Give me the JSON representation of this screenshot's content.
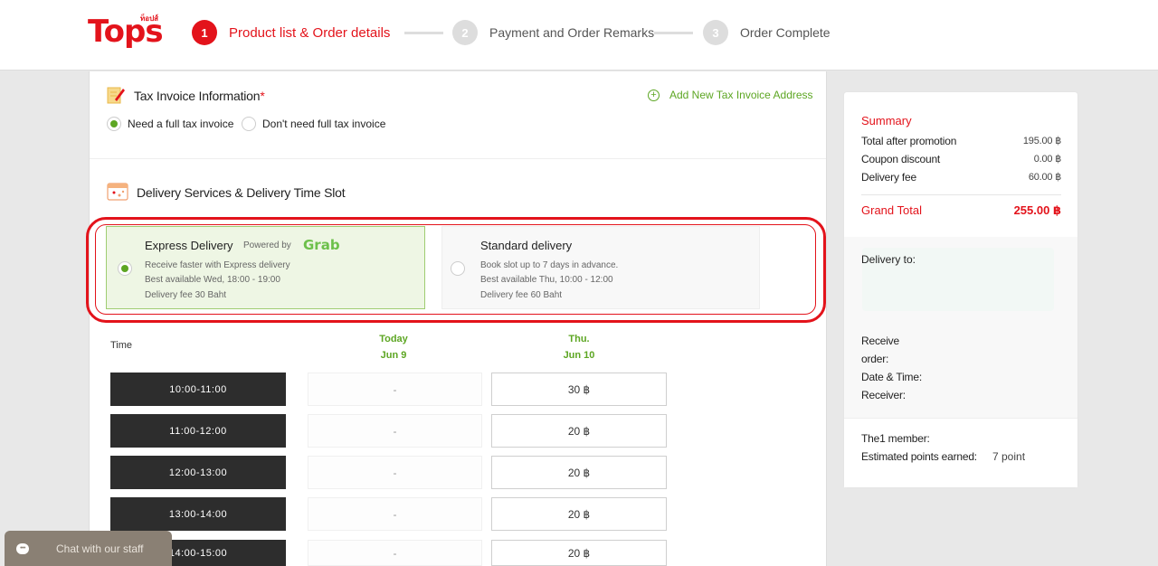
{
  "brand": {
    "logo_text": "Tops",
    "logo_sup": "ท็อปส์",
    "accent": "#e3131b",
    "green": "#5da623"
  },
  "steps": [
    {
      "num": "1",
      "label": "Product list & Order details",
      "state": "active"
    },
    {
      "num": "2",
      "label": "Payment and Order Remarks",
      "state": "inactive"
    },
    {
      "num": "3",
      "label": "Order Complete",
      "state": "inactive"
    }
  ],
  "tax": {
    "title": "Tax Invoice Information",
    "required_mark": "*",
    "add_label": "Add New Tax Invoice Address",
    "options": [
      {
        "label": "Need a full tax invoice",
        "selected": true
      },
      {
        "label": "Don't need full tax invoice",
        "selected": false
      }
    ]
  },
  "delivery": {
    "title": "Delivery Services & Delivery Time Slot",
    "express": {
      "title": "Express Delivery",
      "powered": "Powered by",
      "partner": "Grab",
      "lines": [
        "Receive faster with Express delivery",
        "Best available Wed, 18:00 - 19:00",
        "Delivery fee 30 Baht"
      ],
      "selected": true
    },
    "standard": {
      "title": "Standard delivery",
      "lines": [
        "Book slot up to 7 days in advance.",
        "Best available Thu, 10:00 - 12:00",
        "Delivery fee 60 Baht"
      ],
      "selected": false
    }
  },
  "schedule": {
    "time_header": "Time",
    "days": [
      {
        "name": "Today",
        "date": "Jun 9"
      },
      {
        "name": "Thu.",
        "date": "Jun 10"
      }
    ],
    "slots": [
      {
        "time": "10:00-11:00",
        "today": "-",
        "thu": "30 ฿"
      },
      {
        "time": "11:00-12:00",
        "today": "-",
        "thu": "20 ฿"
      },
      {
        "time": "12:00-13:00",
        "today": "-",
        "thu": "20 ฿"
      },
      {
        "time": "13:00-14:00",
        "today": "-",
        "thu": "20 ฿"
      },
      {
        "time": "14:00-15:00",
        "today": "-",
        "thu": "20 ฿"
      }
    ]
  },
  "summary": {
    "title": "Summary",
    "rows": [
      {
        "label": "Total after promotion",
        "value": "195.00 ฿"
      },
      {
        "label": "Coupon discount",
        "value": "0.00 ฿"
      },
      {
        "label": "Delivery fee",
        "value": "60.00 ฿"
      }
    ],
    "grand_label": "Grand Total",
    "grand_value": "255.00 ฿",
    "deliver_to": "Delivery to:",
    "receive_label_1": "Receive",
    "receive_label_2": "order:",
    "datetime_label": "Date & Time:",
    "receiver_label": "Receiver:",
    "member_label": "The1 member:",
    "points_label": "Estimated points earned:",
    "points_value": "7 point"
  },
  "chat": {
    "label": "Chat with our staff"
  }
}
